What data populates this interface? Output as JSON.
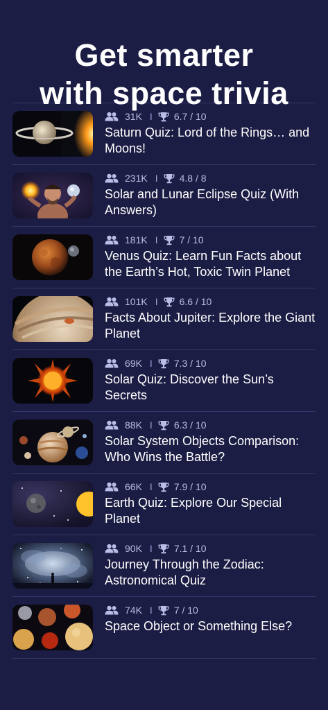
{
  "header": {
    "line1": "Get smarter",
    "line2": "with space trivia"
  },
  "quizzes": [
    {
      "players": "31K",
      "rating": "6.7 / 10",
      "title": "Saturn Quiz: Lord of the Rings… and Moons!",
      "thumb": "saturn-thumbnail"
    },
    {
      "players": "231K",
      "rating": "4.8 / 8",
      "title": "Solar and Lunar Eclipse Quiz (With Answers)",
      "thumb": "eclipse-thumbnail"
    },
    {
      "players": "181K",
      "rating": "7 / 10",
      "title": "Venus Quiz: Learn Fun Facts about the Earth’s Hot, Toxic Twin Planet",
      "thumb": "venus-thumbnail"
    },
    {
      "players": "101K",
      "rating": "6.6 / 10",
      "title": "Facts About Jupiter: Explore the Giant Planet",
      "thumb": "jupiter-thumbnail"
    },
    {
      "players": "69K",
      "rating": "7.3 / 10",
      "title": "Solar Quiz: Discover the Sun’s Secrets",
      "thumb": "sun-thumbnail"
    },
    {
      "players": "88K",
      "rating": "6.3 / 10",
      "title": "Solar System Objects Comparison: Who Wins the Battle?",
      "thumb": "solar-system-thumbnail"
    },
    {
      "players": "66K",
      "rating": "7.9 / 10",
      "title": "Earth Quiz: Explore Our Special Planet",
      "thumb": "earth-thumbnail"
    },
    {
      "players": "90K",
      "rating": "7.1 / 10",
      "title": "Journey Through the Zodiac: Astronomical Quiz",
      "thumb": "zodiac-thumbnail"
    },
    {
      "players": "74K",
      "rating": "7 / 10",
      "title": "Space Object or Something Else?",
      "thumb": "space-objects-thumbnail"
    }
  ],
  "icons": {
    "players": "users-icon",
    "rating": "trophy-icon"
  },
  "colors": {
    "background": "#1c1d44",
    "meta": "#b9bde8",
    "divider": "#35376a"
  }
}
